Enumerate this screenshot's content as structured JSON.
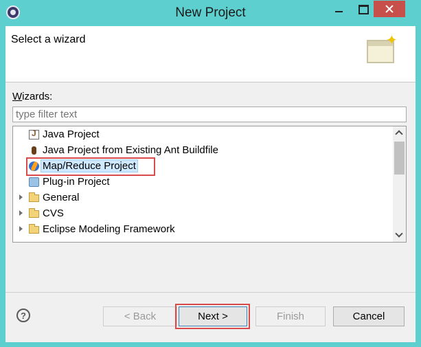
{
  "window": {
    "title": "New Project"
  },
  "header": {
    "title": "Select a wizard",
    "banner_icon": "wizard-banner-icon"
  },
  "wizards": {
    "label_prefix": "W",
    "label_rest": "izards:",
    "filter_placeholder": "type filter text",
    "items": [
      {
        "label": "Java Project",
        "icon": "java-project-icon"
      },
      {
        "label": "Java Project from Existing Ant Buildfile",
        "icon": "ant-icon"
      },
      {
        "label": "Map/Reduce Project",
        "icon": "map-reduce-icon",
        "selected": true
      },
      {
        "label": "Plug-in Project",
        "icon": "plugin-icon"
      },
      {
        "label": "General",
        "icon": "folder-icon",
        "expandable": true
      },
      {
        "label": "CVS",
        "icon": "folder-icon",
        "expandable": true
      },
      {
        "label": "Eclipse Modeling Framework",
        "icon": "folder-icon",
        "expandable": true
      }
    ]
  },
  "buttons": {
    "help": "?",
    "back": "< Back",
    "next": "Next >",
    "finish": "Finish",
    "cancel": "Cancel"
  },
  "colors": {
    "titlebar": "#5ecfcf",
    "close": "#c7514a",
    "annotation": "#d94a4a",
    "selection": "#cde8ff"
  }
}
